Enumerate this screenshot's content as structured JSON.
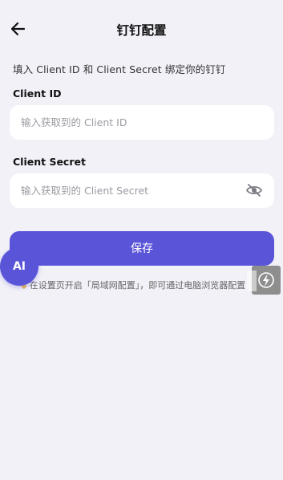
{
  "header": {
    "title": "钉钉配置",
    "back_icon": "arrow-left-icon"
  },
  "intro_text": "填入 Client ID 和 Client Secret 绑定你的钉钉",
  "client_id": {
    "label": "Client ID",
    "value": "",
    "placeholder": "输入获取到的 Client ID"
  },
  "client_secret": {
    "label": "Client Secret",
    "value": "",
    "placeholder": "输入获取到的 Client Secret",
    "visibility_icon": "eye-off-icon"
  },
  "save_label": "保存",
  "ai_label": "AI",
  "tip": {
    "icon": "lightbulb-icon",
    "text": "在设置页开启「局域网配置」，即可通过电脑浏览器配置"
  },
  "colors": {
    "primary": "#5a54d9",
    "background": "#f2f1f8"
  }
}
